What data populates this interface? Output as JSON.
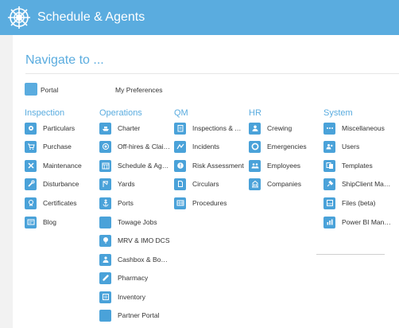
{
  "header": {
    "title": "Schedule & Agents"
  },
  "nav": {
    "title": "Navigate to ..."
  },
  "top": {
    "portal": "Portal",
    "preferences": "My Preferences"
  },
  "columns": {
    "inspection": {
      "title": "Inspection",
      "items": [
        "Particulars",
        "Purchase",
        "Maintenance",
        "Disturbance",
        "Certificates",
        "Blog"
      ]
    },
    "operations": {
      "title": "Operations",
      "items": [
        "Charter",
        "Off-hires & Claims",
        "Schedule & Agents",
        "Yards",
        "Ports",
        "Towage Jobs",
        "MRV & IMO DCS",
        "Cashbox & Bond...",
        "Pharmacy",
        "Inventory",
        "Partner Portal"
      ]
    },
    "qm": {
      "title": "QM",
      "items": [
        "Inspections & Au...",
        "Incidents",
        "Risk Assessment",
        "Circulars",
        "Procedures"
      ]
    },
    "hr": {
      "title": "HR",
      "items": [
        "Crewing",
        "Emergencies",
        "Employees",
        "Companies"
      ]
    },
    "system": {
      "title": "System",
      "items": [
        "Miscellaneous",
        "Users",
        "Templates",
        "ShipClient Mana...",
        "Files (beta)",
        "Power BI Manag..."
      ]
    }
  }
}
